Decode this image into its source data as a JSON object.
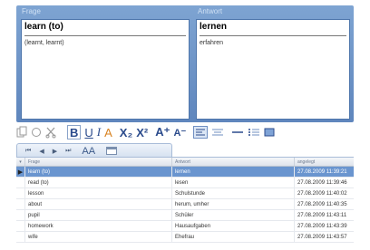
{
  "editor": {
    "frage_label": "Frage",
    "antwort_label": "Antwort",
    "frage_word": "learn (to)",
    "frage_note": "(learnt, learnt)",
    "antwort_word": "lernen",
    "antwort_note": "erfahren"
  },
  "toolbar": {
    "buttons": [
      "copy-icon",
      "paste-icon",
      "cut-icon",
      "bold-icon",
      "underline-icon",
      "italic-icon",
      "text-color-icon",
      "subscript-icon",
      "superscript-icon",
      "font-larger-icon",
      "font-smaller-icon",
      "align-left-icon",
      "align-center-icon",
      "horizontal-rule-icon",
      "list-icon",
      "image-icon"
    ],
    "bold": "B",
    "underline": "U",
    "italic": "I",
    "text_color": "A",
    "subscript": "X₂",
    "superscript": "X²",
    "font_larger": "A⁺",
    "font_smaller": "A⁻"
  },
  "nav": {
    "first": "⏮",
    "prev": "◀",
    "next": "▶",
    "last": "⏭",
    "font": "AA"
  },
  "table": {
    "headers": [
      "Frage",
      "Antwort",
      "angelegt"
    ],
    "rows": [
      {
        "frage": "learn (to)",
        "antwort": "lernen",
        "angelegt": "27.08.2009 11:39:21",
        "selected": true
      },
      {
        "frage": "read (to)",
        "antwort": "lesen",
        "angelegt": "27.08.2009 11:39:46",
        "selected": false
      },
      {
        "frage": "lesson",
        "antwort": "Schulstunde",
        "angelegt": "27.08.2009 11:40:02",
        "selected": false
      },
      {
        "frage": "about",
        "antwort": "herum, umher",
        "angelegt": "27.08.2009 11:40:35",
        "selected": false
      },
      {
        "frage": "pupil",
        "antwort": "Schüler",
        "angelegt": "27.08.2009 11:43:11",
        "selected": false
      },
      {
        "frage": "homework",
        "antwort": "Hausaufgaben",
        "angelegt": "27.08.2009 11:43:39",
        "selected": false
      },
      {
        "frage": "wife",
        "antwort": "Ehefrau",
        "angelegt": "27.08.2009 11:43:57",
        "selected": false
      }
    ]
  },
  "colors": {
    "panel": "#6f96c8",
    "selection": "#6a95cf",
    "accent": "#2b4b8c"
  }
}
